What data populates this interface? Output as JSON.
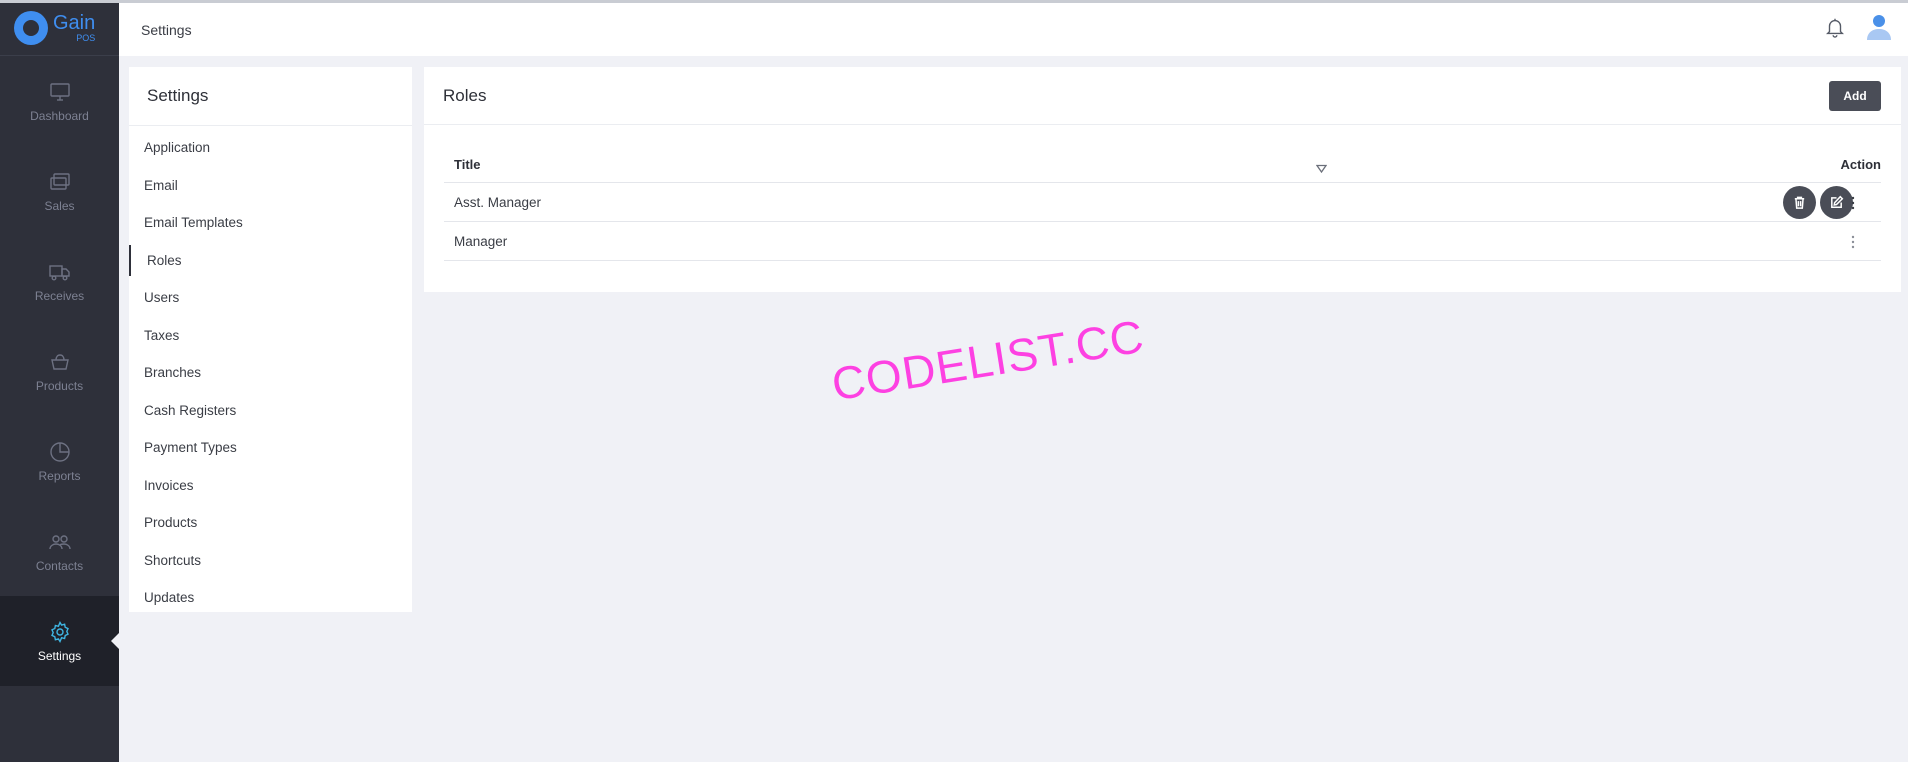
{
  "app": {
    "name": "Gain",
    "subname": "POS"
  },
  "header": {
    "title": "Settings"
  },
  "sidebar": {
    "items": [
      {
        "label": "Dashboard",
        "icon": "monitor-icon"
      },
      {
        "label": "Sales",
        "icon": "sales-icon"
      },
      {
        "label": "Receives",
        "icon": "truck-icon"
      },
      {
        "label": "Products",
        "icon": "products-icon"
      },
      {
        "label": "Reports",
        "icon": "pie-chart-icon"
      },
      {
        "label": "Contacts",
        "icon": "users-icon"
      },
      {
        "label": "Settings",
        "icon": "gear-icon",
        "active": true
      }
    ]
  },
  "settings_menu": {
    "title": "Settings",
    "items": [
      "Application",
      "Email",
      "Email Templates",
      "Roles",
      "Users",
      "Taxes",
      "Branches",
      "Cash Registers",
      "Payment Types",
      "Invoices",
      "Products",
      "Shortcuts",
      "Updates"
    ],
    "active": "Roles"
  },
  "roles": {
    "title": "Roles",
    "add_label": "Add",
    "columns": {
      "title": "Title",
      "action": "Action"
    },
    "rows": [
      {
        "title": "Asst. Manager"
      },
      {
        "title": "Manager"
      }
    ]
  },
  "watermark": "CODELIST.CC",
  "colors": {
    "sidebar_bg": "#2e303a",
    "active_bg": "#1f2129",
    "accent": "#3f8ef0",
    "active_icon": "#3fb6e3",
    "button_bg": "#4a4d57",
    "page_bg": "#f0f1f6",
    "watermark": "#ff2fe0"
  }
}
